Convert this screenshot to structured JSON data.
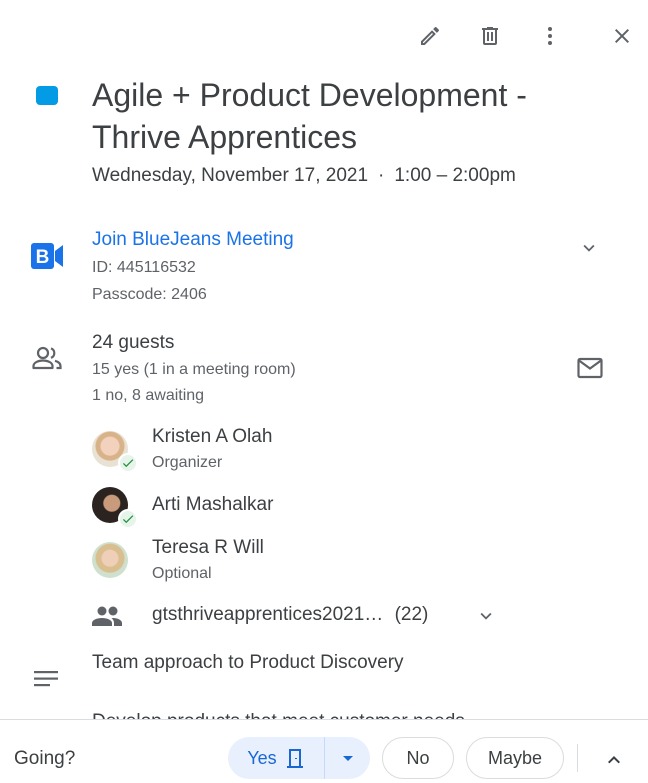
{
  "event": {
    "title": "Agile + Product Development - Thrive Apprentices",
    "date": "Wednesday, November 17, 2021",
    "separator": "·",
    "time": "1:00 – 2:00pm",
    "color": "#039be5"
  },
  "toolbar": {
    "edit_icon": "pencil-icon",
    "delete_icon": "trash-icon",
    "more_icon": "more-vert-icon",
    "close_icon": "close-icon"
  },
  "meeting": {
    "join_label": "Join BlueJeans Meeting",
    "id_text": "ID: 445116532",
    "passcode_text": "Passcode: 2406"
  },
  "guests": {
    "count_label": "24 guests",
    "yes_summary": "15 yes (1 in a meeting room)",
    "other_summary": "1 no, 8 awaiting",
    "list": [
      {
        "name": "Kristen A Olah",
        "role": "Organizer",
        "accepted": true
      },
      {
        "name": "Arti Mashalkar",
        "role": "",
        "accepted": true
      },
      {
        "name": "Teresa R Will",
        "role": "Optional",
        "accepted": false
      }
    ],
    "group": {
      "name": "gtsthriveapprentices2021…",
      "count": "(22)"
    }
  },
  "description": {
    "line1": "Team approach to Product Discovery",
    "line2": "Develop products that meet customer needs"
  },
  "rsvp": {
    "going_label": "Going?",
    "yes_label": "Yes",
    "no_label": "No",
    "maybe_label": "Maybe"
  }
}
